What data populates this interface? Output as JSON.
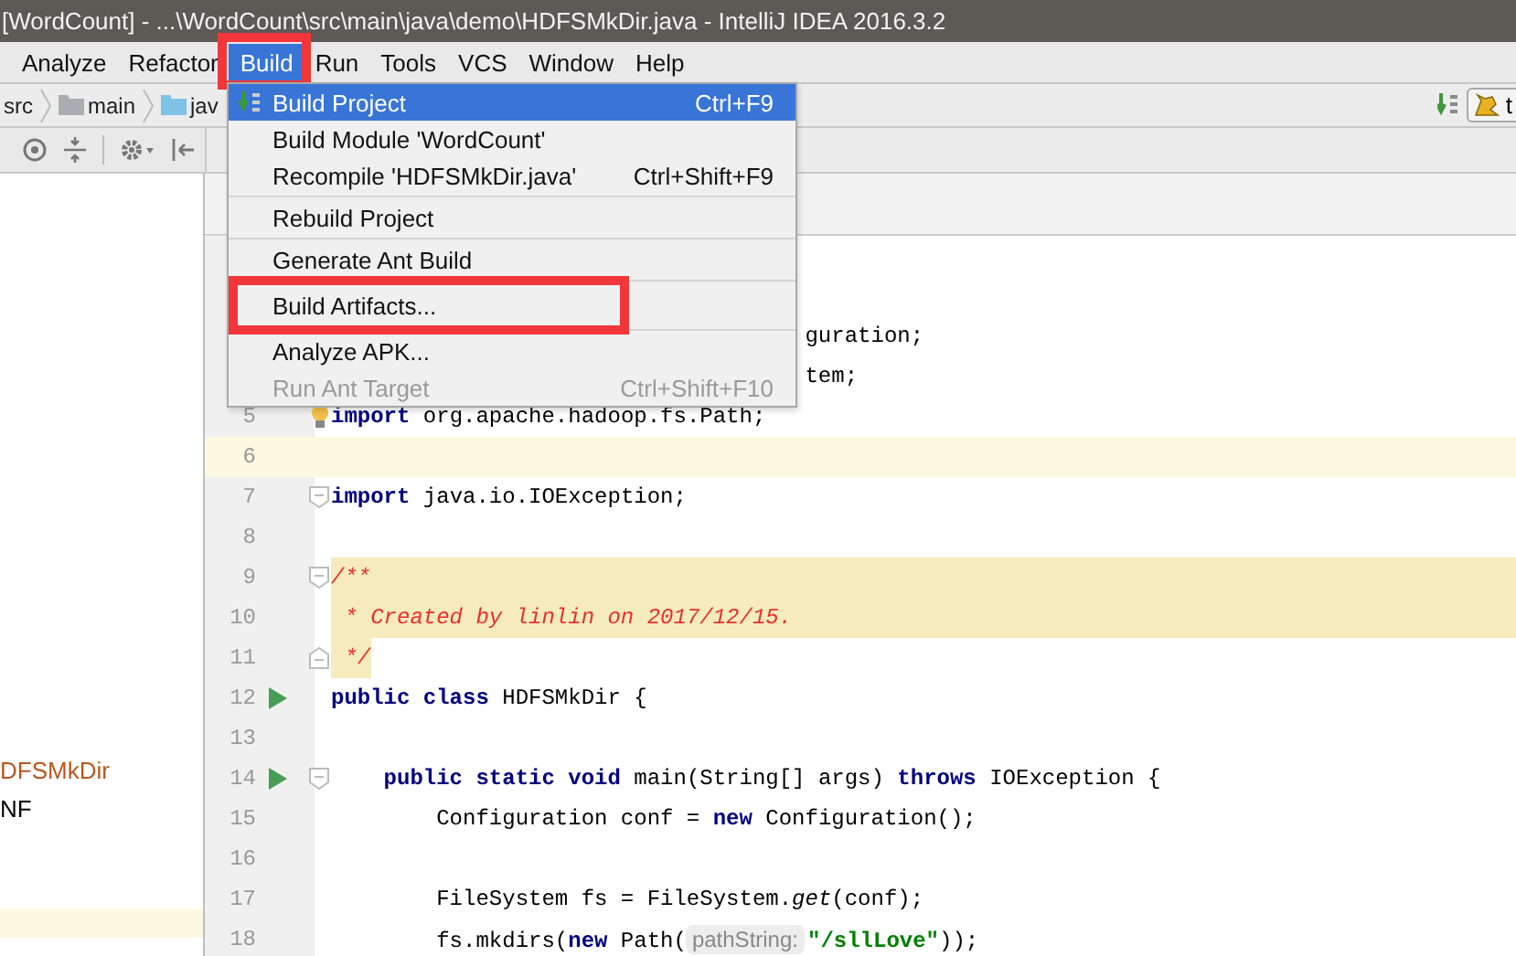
{
  "window": {
    "title": "[WordCount] - ...\\WordCount\\src\\main\\java\\demo\\HDFSMkDir.java - IntelliJ IDEA 2016.3.2"
  },
  "menubar": [
    {
      "label": "Analyze",
      "selected": false,
      "highlighted": false
    },
    {
      "label": "Refactor",
      "selected": false,
      "highlighted": false
    },
    {
      "label": "Build",
      "selected": true,
      "highlighted": true
    },
    {
      "label": "Run",
      "selected": false,
      "highlighted": false
    },
    {
      "label": "Tools",
      "selected": false,
      "highlighted": false
    },
    {
      "label": "VCS",
      "selected": false,
      "highlighted": false
    },
    {
      "label": "Window",
      "selected": false,
      "highlighted": false
    },
    {
      "label": "Help",
      "selected": false,
      "highlighted": false
    }
  ],
  "breadcrumbs": [
    {
      "label": "src",
      "kind": "plain"
    },
    {
      "label": "main",
      "kind": "folder"
    },
    {
      "label": "jav",
      "kind": "source"
    }
  ],
  "nav_right": {
    "config_label": "t"
  },
  "menu": [
    {
      "label": "Build Project",
      "shortcut": "Ctrl+F9",
      "selected": true,
      "disabled": false,
      "highlighted": false,
      "icon": true,
      "separator_after": false
    },
    {
      "label": "Build Module 'WordCount'",
      "selected": false,
      "disabled": false,
      "highlighted": false,
      "separator_after": false
    },
    {
      "label": "Recompile 'HDFSMkDir.java'",
      "shortcut": "Ctrl+Shift+F9",
      "selected": false,
      "disabled": false,
      "highlighted": false,
      "separator_after": true
    },
    {
      "label": "Rebuild Project",
      "selected": false,
      "disabled": false,
      "highlighted": false,
      "separator_after": true
    },
    {
      "label": "Generate Ant Build",
      "selected": false,
      "disabled": false,
      "highlighted": false,
      "separator_after": true
    },
    {
      "label": "Build Artifacts...",
      "selected": false,
      "disabled": false,
      "highlighted": true,
      "separator_after": true
    },
    {
      "label": "Analyze APK...",
      "selected": false,
      "disabled": false,
      "highlighted": false,
      "separator_after": false
    },
    {
      "label": "Run Ant Target",
      "shortcut": "Ctrl+Shift+F10",
      "selected": false,
      "disabled": true,
      "highlighted": false,
      "separator_after": false
    }
  ],
  "project_tree": [
    {
      "label": "DFSMkDir",
      "kind": "class"
    },
    {
      "label": "NF",
      "kind": "plain"
    }
  ],
  "editor": {
    "lines": [
      {
        "covered": true,
        "tokens": [
          {
            "kind": "plain",
            "text": "guration;"
          }
        ]
      },
      {
        "covered": true,
        "tokens": [
          {
            "kind": "plain",
            "text": "tem;"
          }
        ]
      },
      {
        "number": "5",
        "bulb": true,
        "tokens": [
          {
            "kind": "kw",
            "text": "import"
          },
          {
            "kind": "plain",
            "text": " org.apache.hadoop.fs.Path;"
          }
        ]
      },
      {
        "number": "6",
        "caret_line": true
      },
      {
        "number": "7",
        "fold_start": true,
        "tokens": [
          {
            "kind": "kw",
            "text": "import"
          },
          {
            "kind": "plain",
            "text": " java.io.IOException;"
          }
        ]
      },
      {
        "number": "8"
      },
      {
        "number": "9",
        "doc_comment": true,
        "fold_start": true,
        "tokens": [
          {
            "kind": "comment",
            "text": "/**"
          }
        ]
      },
      {
        "number": "10",
        "doc_comment": true,
        "tokens": [
          {
            "kind": "comment",
            "text": " * Created by linlin on 2017/12/15."
          }
        ]
      },
      {
        "number": "11",
        "doc_comment_tail": true,
        "fold_end": true,
        "tokens": [
          {
            "kind": "comment",
            "text": " */"
          }
        ]
      },
      {
        "number": "12",
        "run": true,
        "tokens": [
          {
            "kind": "kw",
            "text": "public class"
          },
          {
            "kind": "plain",
            "text": " HDFSMkDir {"
          }
        ]
      },
      {
        "number": "13"
      },
      {
        "number": "14",
        "run": true,
        "fold_start": true,
        "tokens": [
          {
            "kind": "kw",
            "text": "    public static void"
          },
          {
            "kind": "plain",
            "text": " main(String[] args) "
          },
          {
            "kind": "kw",
            "text": "throws"
          },
          {
            "kind": "plain",
            "text": " IOException {"
          }
        ]
      },
      {
        "number": "15",
        "tokens": [
          {
            "kind": "plain",
            "text": "        Configuration conf = "
          },
          {
            "kind": "kw",
            "text": "new"
          },
          {
            "kind": "plain",
            "text": " Configuration();"
          }
        ]
      },
      {
        "number": "16"
      },
      {
        "number": "17",
        "tokens": [
          {
            "kind": "plain",
            "text": "        FileSystem fs = FileSystem."
          },
          {
            "kind": "italic",
            "text": "get"
          },
          {
            "kind": "plain",
            "text": "(conf);"
          }
        ]
      },
      {
        "number": "18",
        "tokens": [
          {
            "kind": "plain",
            "text": "        fs.mkdirs("
          },
          {
            "kind": "kw",
            "text": "new"
          },
          {
            "kind": "plain",
            "text": " Path("
          },
          {
            "kind": "hint",
            "text": "pathString:"
          },
          {
            "kind": "string",
            "text": "\"/sllLove\""
          },
          {
            "kind": "plain",
            "text": "));"
          }
        ]
      }
    ]
  }
}
